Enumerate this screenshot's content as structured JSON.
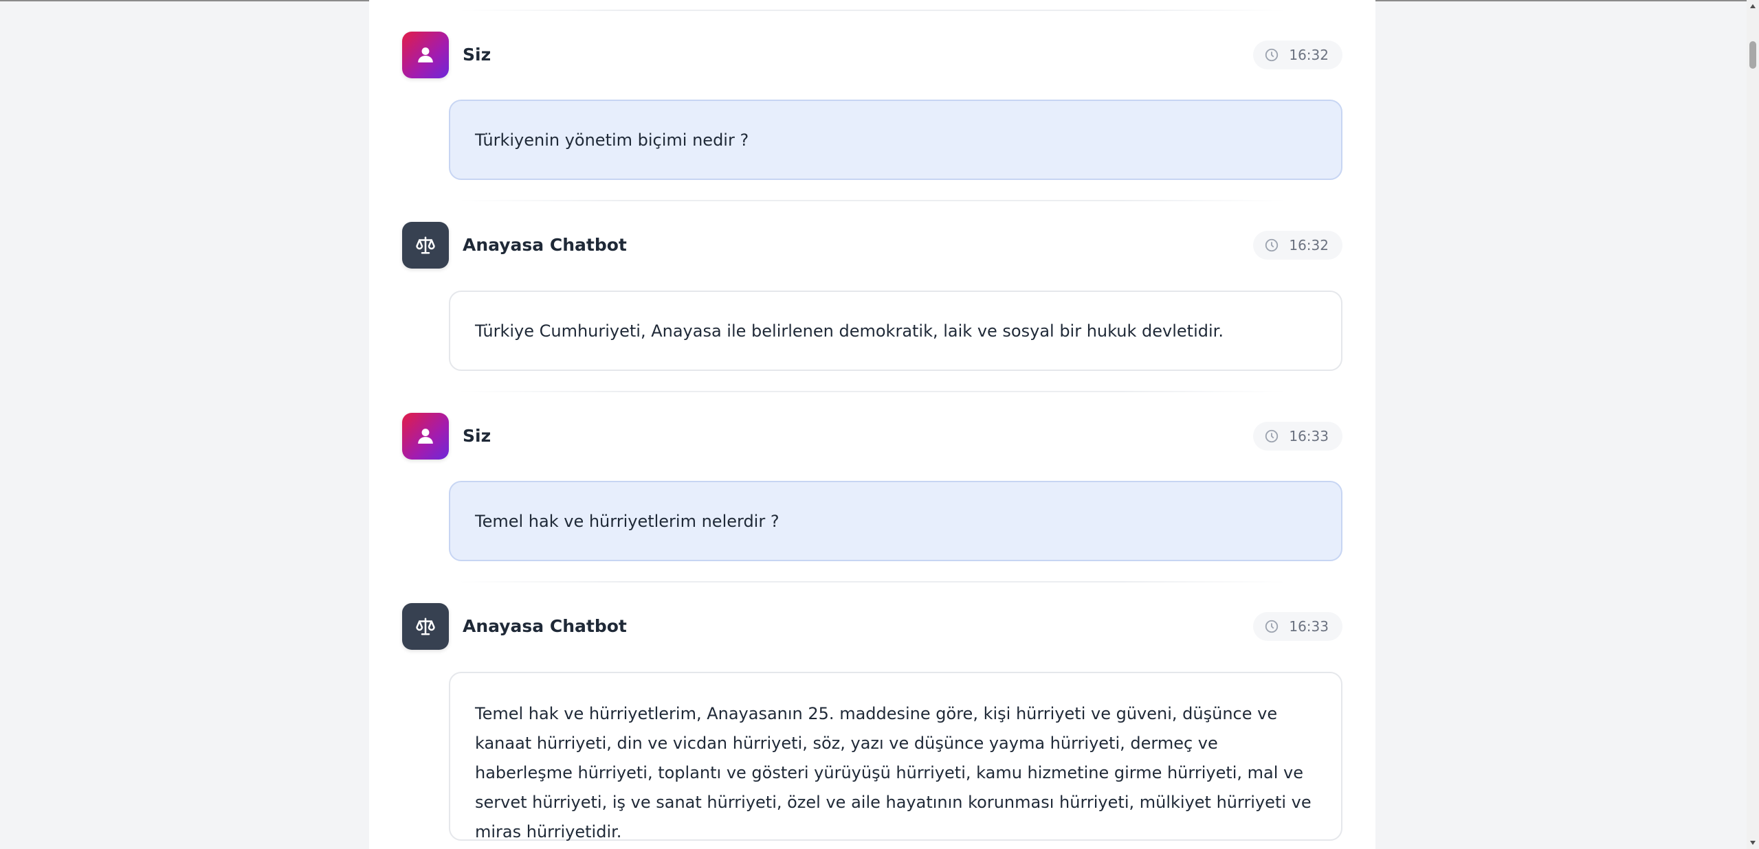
{
  "messages": [
    {
      "sender": "Siz",
      "time": "16:32",
      "text": "Türkiyenin yönetim biçimi nedir ?"
    },
    {
      "sender": "Anayasa Chatbot",
      "time": "16:32",
      "text": "Türkiye Cumhuriyeti, Anayasa ile belirlenen demokratik, laik ve sosyal bir hukuk devletidir."
    },
    {
      "sender": "Siz",
      "time": "16:33",
      "text": "Temel hak ve hürriyetlerim nelerdir ?"
    },
    {
      "sender": "Anayasa Chatbot",
      "time": "16:33",
      "text": "Temel hak ve hürriyetlerim, Anayasanın 25. maddesine göre, kişi hürriyeti ve güveni, düşünce ve kanaat hürriyeti, din ve vicdan hürriyeti, söz, yazı ve düşünce yayma hürriyeti, dermeç ve haberleşme hürriyeti, toplantı ve gösteri yürüyüşü hürriyeti, kamu hizmetine girme hürriyeti, mal ve servet hürriyeti, iş ve sanat hürriyeti, özel ve aile hayatının korunması hürriyeti, mülkiyet hürriyeti ve miras hürriyetidir."
    }
  ],
  "icons": {
    "user_avatar": "user-icon",
    "bot_avatar": "scale-icon",
    "time": "clock-icon"
  },
  "colors": {
    "user_bubble": "#e7eefc",
    "bot_avatar": "#374151",
    "user_avatar_gradient": [
      "#e11d48",
      "#6d28d9"
    ]
  }
}
